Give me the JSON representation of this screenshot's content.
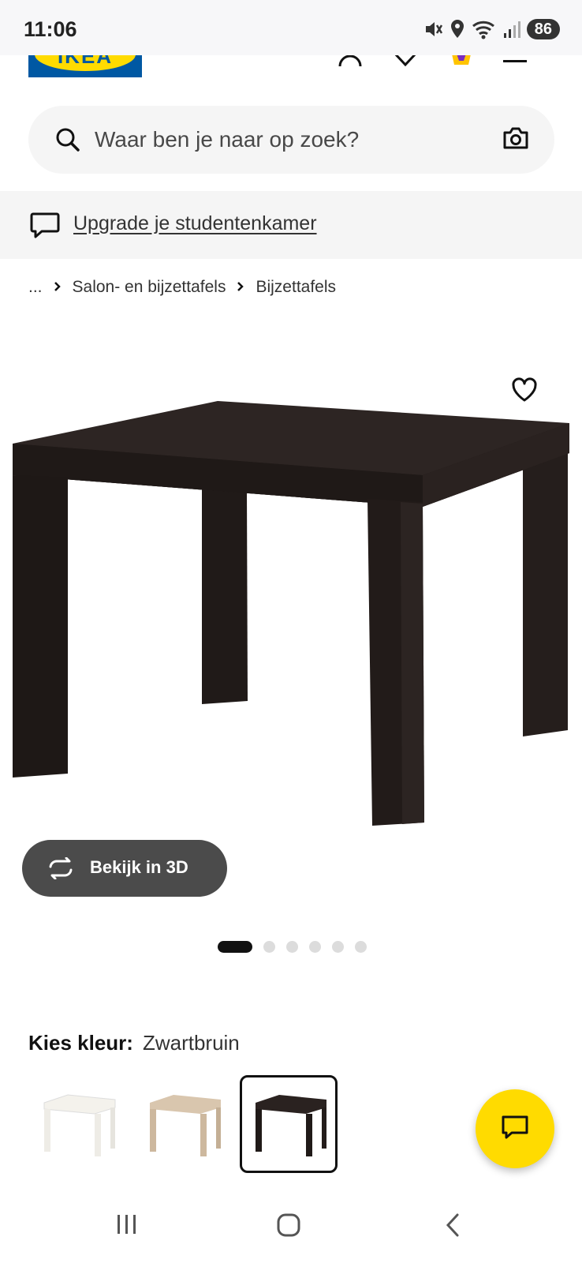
{
  "status_bar": {
    "time": "11:06",
    "battery": "86",
    "icons": [
      "mute-icon",
      "location-icon",
      "wifi-icon",
      "signal-icon"
    ]
  },
  "header": {
    "logo_text": "IKEA",
    "icons": [
      "account-icon",
      "wishlist-heart-icon",
      "bag-icon",
      "menu-icon"
    ]
  },
  "search": {
    "placeholder": "Waar ben je naar op zoek?"
  },
  "promo_banner": {
    "text": "Upgrade je studentenkamer"
  },
  "breadcrumb": {
    "items": [
      "...",
      "Salon- en bijzettafels",
      "Bijzettafels"
    ]
  },
  "product_gallery": {
    "view_3d_label": "Bekijk in 3D",
    "image_count": 6,
    "active_index": 0
  },
  "color_picker": {
    "label": "Kies kleur:",
    "selected": "Zwartbruin",
    "swatches": [
      {
        "color": "#f4f2ec",
        "selected": false
      },
      {
        "color": "#d9c6ae",
        "selected": false
      },
      {
        "color": "#2a2220",
        "selected": true
      }
    ]
  },
  "colors": {
    "ikea_blue": "#0058a3",
    "ikea_yellow": "#ffdb00",
    "table_dark": "#2a2220"
  }
}
